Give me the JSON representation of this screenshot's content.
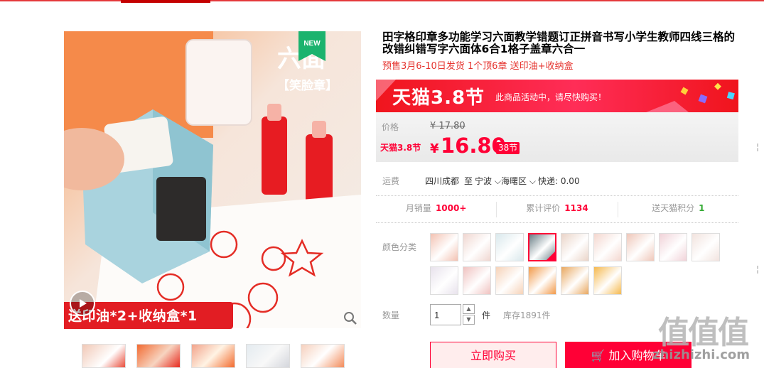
{
  "title": "田字格印章多功能学习六面教学错题订正拼音书写小学生教师四线三格的改错纠错写字六面体6合1格子盖章六合一",
  "subtitle": "预售3月6-10日发货 1个顶6章 送印油+收纳盒",
  "gallery": {
    "badge": "NEW",
    "product_text_line1": "六面",
    "product_text_line2": "【笑脸章】",
    "promo_text": "送印油*2+收纳盒*1"
  },
  "banner": {
    "logo": "天猫3.8节",
    "note": "此商品活动中，请尽快购买！"
  },
  "price": {
    "price_label": "价格",
    "original_currency": "¥",
    "original": "17.80",
    "promo_label": "天猫3.8节",
    "currency": "¥",
    "current": "16.80",
    "tag": "38节"
  },
  "shipping": {
    "label": "运费",
    "from": "四川成都",
    "to_prefix": "至",
    "city": "宁波",
    "district": "海曙区",
    "fee": "快递: 0.00"
  },
  "stats": {
    "sales_label": "月销量",
    "sales_value": "1000+",
    "reviews_label": "累计评价",
    "reviews_value": "1134",
    "points_label": "送天猫积分",
    "points_value": "1"
  },
  "options": {
    "label": "颜色分类",
    "selected_index": 3,
    "swatch_colors": [
      "#f3c2b2",
      "#f0d6d0",
      "#d9e8ec",
      "#6a7f86",
      "#ead4c8",
      "#f4d7cf",
      "#efc7b9",
      "#f1d2d8",
      "#f2e3de",
      "#e8e2ec",
      "#f0c2c0",
      "#f6d2b8",
      "#f29a4a",
      "#e9a860",
      "#f5b94f"
    ]
  },
  "quantity": {
    "label": "数量",
    "value": "1",
    "unit": "件",
    "stock": "库存1891件"
  },
  "actions": {
    "buy_now": "立即购买",
    "add_to_cart": "加入购物车"
  },
  "watermark": {
    "logo": "值值值",
    "url": "zhizhizhi.com"
  },
  "edge": {
    "char1": "¦",
    "char2": "¦"
  }
}
